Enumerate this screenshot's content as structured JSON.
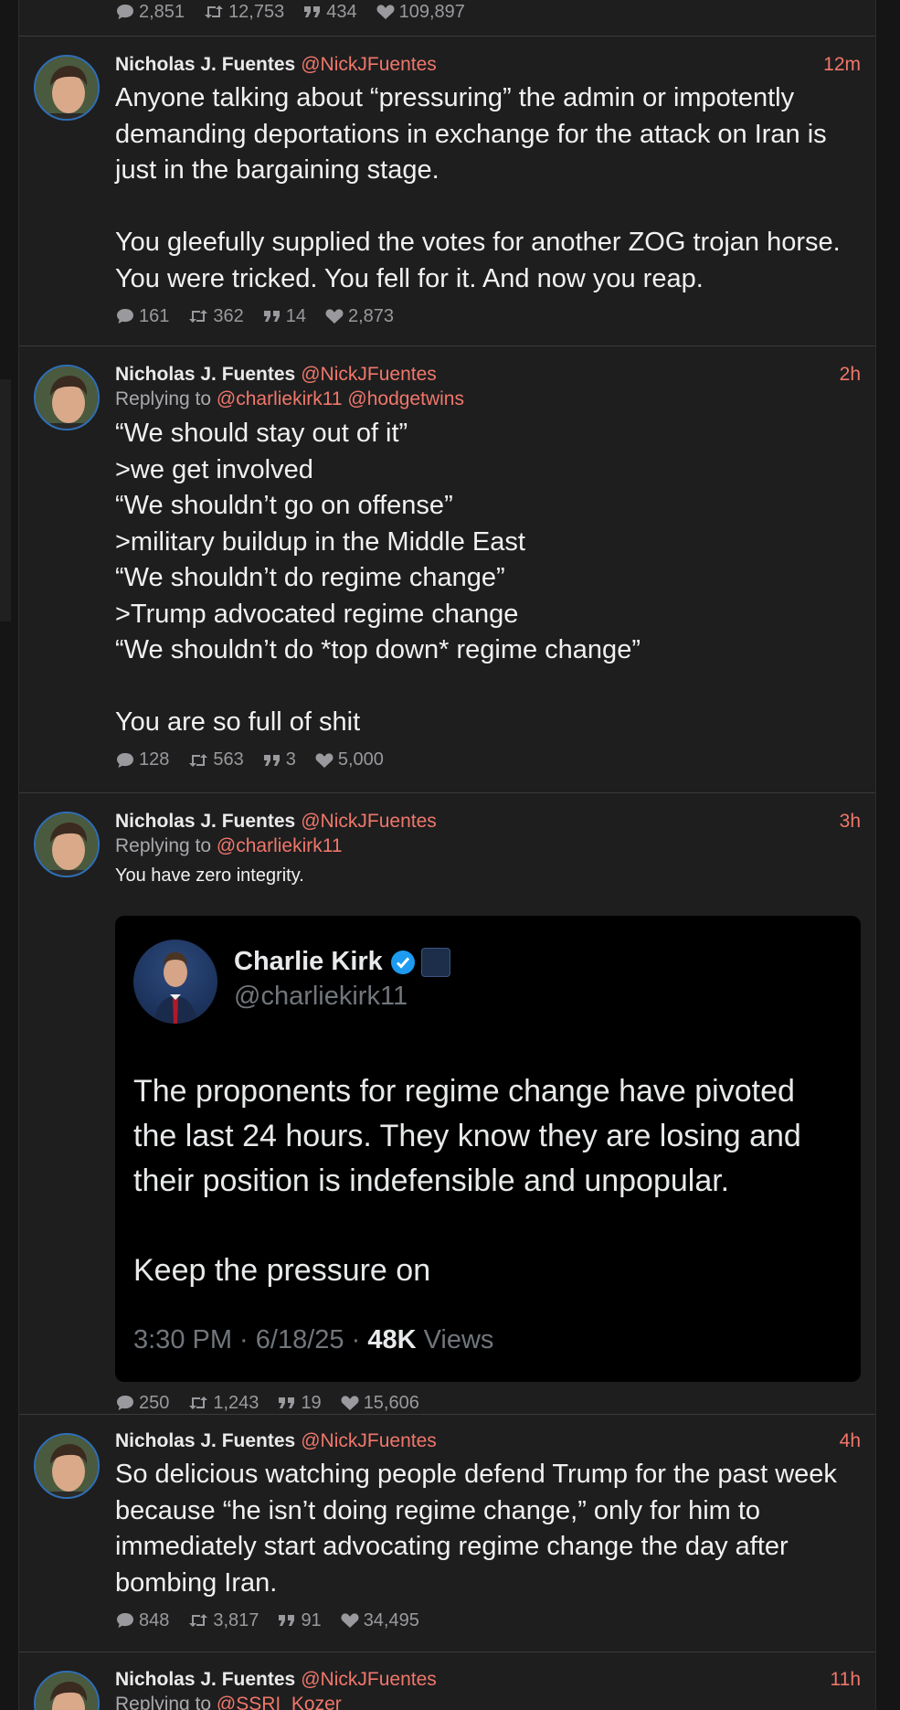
{
  "colors": {
    "accent": "#f0776a",
    "background": "#1e1e1f",
    "text": "#f1f1f1",
    "muted": "#9a9a9e"
  },
  "top_stats": {
    "replies": "2,851",
    "reposts": "12,753",
    "quotes": "434",
    "likes": "109,897"
  },
  "posts": [
    {
      "name": "Nicholas J. Fuentes",
      "handle": "@NickJFuentes",
      "time": "12m",
      "text": "Anyone talking about “pressuring” the admin or impotently demanding deportations in exchange for the attack on Iran is just in the bargaining stage.\n\nYou gleefully supplied the votes for another ZOG trojan horse. You were tricked. You fell for it. And now you reap.",
      "stats": {
        "replies": "161",
        "reposts": "362",
        "quotes": "14",
        "likes": "2,873"
      }
    },
    {
      "name": "Nicholas J. Fuentes",
      "handle": "@NickJFuentes",
      "time": "2h",
      "reply_prefix": "Replying to",
      "reply_mentions": [
        "@charliekirk11",
        "@hodgetwins"
      ],
      "text": "“We should stay out of it”\n>we get involved\n“We shouldn’t go on offense”\n>military buildup in the Middle East\n“We shouldn’t do regime change”\n>Trump advocated regime change\n“We shouldn’t do *top down* regime change”\n\nYou are so full of shit",
      "stats": {
        "replies": "128",
        "reposts": "563",
        "quotes": "3",
        "likes": "5,000"
      }
    },
    {
      "name": "Nicholas J. Fuentes",
      "handle": "@NickJFuentes",
      "time": "3h",
      "reply_prefix": "Replying to",
      "reply_mentions": [
        "@charliekirk11"
      ],
      "text": "You have zero integrity.",
      "embedded": {
        "name": "Charlie Kirk",
        "handle": "@charliekirk11",
        "text": "The proponents for regime change have pivoted the last 24 hours. They know they are losing and their position is indefensible and unpopular.\n\nKeep the pressure on",
        "meta_time": "3:30 PM · 6/18/25 ·",
        "meta_views_count": "48K",
        "meta_views_label": "Views"
      },
      "stats": {
        "replies": "250",
        "reposts": "1,243",
        "quotes": "19",
        "likes": "15,606"
      }
    },
    {
      "name": "Nicholas J. Fuentes",
      "handle": "@NickJFuentes",
      "time": "4h",
      "text": "So delicious watching people defend Trump for the past week because “he isn’t doing regime change,” only for him to immediately start advocating regime change the day after bombing Iran.",
      "stats": {
        "replies": "848",
        "reposts": "3,817",
        "quotes": "91",
        "likes": "34,495"
      }
    },
    {
      "name": "Nicholas J. Fuentes",
      "handle": "@NickJFuentes",
      "time": "11h",
      "reply_prefix": "Replying to",
      "reply_mentions": [
        "@SSRI_Kozer"
      ]
    }
  ]
}
